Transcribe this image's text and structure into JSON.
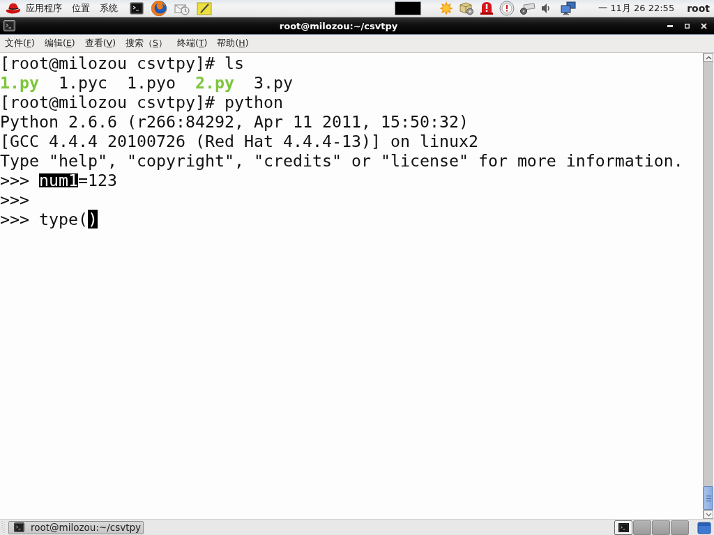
{
  "top_panel": {
    "menus": [
      "应用程序",
      "位置",
      "系统"
    ],
    "clock": "一 11月 26 22:55",
    "user": "root"
  },
  "window": {
    "title": "root@milozou:~/csvtpy"
  },
  "menu_bar": [
    {
      "before": "文件(",
      "key": "F",
      "after": ")"
    },
    {
      "before": "编辑(",
      "key": "E",
      "after": ")"
    },
    {
      "before": "查看(",
      "key": "V",
      "after": ")"
    },
    {
      "before": "搜索（",
      "key": "S",
      "after": "）"
    },
    {
      "before": "终端(",
      "key": "T",
      "after": ")"
    },
    {
      "before": "帮助(",
      "key": "H",
      "after": ")"
    }
  ],
  "terminal": {
    "lines": [
      {
        "kind": "text",
        "text": "[root@milozou csvtpy]# ls"
      },
      {
        "kind": "files",
        "files": [
          {
            "name": "1.py",
            "executable": true
          },
          {
            "name": "1.pyc",
            "executable": false
          },
          {
            "name": "1.pyo",
            "executable": false
          },
          {
            "name": "2.py",
            "executable": true
          },
          {
            "name": "3.py",
            "executable": false
          }
        ]
      },
      {
        "kind": "text",
        "text": "[root@milozou csvtpy]# python"
      },
      {
        "kind": "text",
        "text": "Python 2.6.6 (r266:84292, Apr 11 2011, 15:50:32)"
      },
      {
        "kind": "text",
        "text": "[GCC 4.4.4 20100726 (Red Hat 4.4.4-13)] on linux2"
      },
      {
        "kind": "text",
        "text": "Type \"help\", \"copyright\", \"credits\" or \"license\" for more information."
      },
      {
        "kind": "python",
        "prompt": ">>>",
        "input": [
          {
            "text": "num1",
            "selected": true,
            "cursor": false
          },
          {
            "text": "=123",
            "selected": false,
            "cursor": false
          }
        ]
      },
      {
        "kind": "python",
        "prompt": ">>>"
      },
      {
        "kind": "python",
        "prompt": ">>>",
        "input": [
          {
            "text": "type(",
            "selected": false,
            "cursor": false
          },
          {
            "text": ")",
            "selected": false,
            "cursor": true
          }
        ]
      }
    ]
  },
  "taskbar": {
    "tasks": [
      {
        "label": "root@milozou:~/csvtpy"
      }
    ],
    "workspaces": [
      {
        "selected": true,
        "has_window": true
      },
      {
        "selected": false,
        "has_window": false
      },
      {
        "selected": false,
        "has_window": false
      },
      {
        "selected": false,
        "has_window": false
      }
    ]
  }
}
